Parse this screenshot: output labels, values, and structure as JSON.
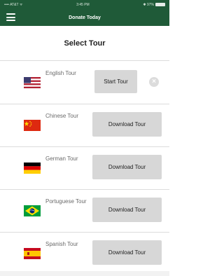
{
  "status_bar": {
    "carrier": "•••• AT&T ᯤ",
    "time": "3:45 PM",
    "battery": "✱ 97%"
  },
  "nav": {
    "title": "Donate Today"
  },
  "page": {
    "title": "Select Tour"
  },
  "tours": [
    {
      "name": "English Tour",
      "flag": "us-flag-icon",
      "action": "Start Tour",
      "cancel": "×"
    },
    {
      "name": "Chinese Tour",
      "flag": "china-flag-icon",
      "action": "Download Tour"
    },
    {
      "name": "German Tour",
      "flag": "germany-flag-icon",
      "action": "Download Tour"
    },
    {
      "name": "Portuguese Tour",
      "flag": "brazil-flag-icon",
      "action": "Download Tour"
    },
    {
      "name": "Spanish Tour",
      "flag": "spain-flag-icon",
      "action": "Download Tour"
    }
  ],
  "colors": {
    "nav_background": "#1f5a38",
    "button_background": "#d7d7d7",
    "divider": "#dcdcdc"
  }
}
